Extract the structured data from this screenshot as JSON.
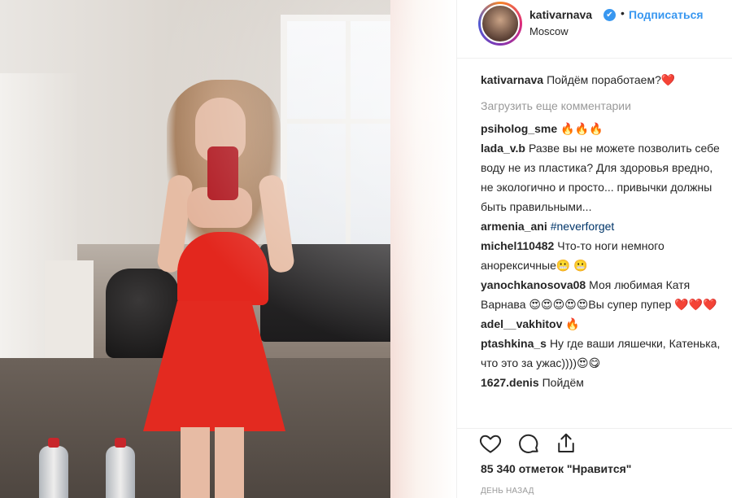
{
  "post": {
    "username": "kativarnava",
    "verified_mark": "✔",
    "dot": "•",
    "follow_label": "Подписаться",
    "location": "Moscow"
  },
  "caption": {
    "user": "kativarnava",
    "text": "Пойдём поработаем?",
    "emoji": "❤️"
  },
  "load_more_label": "Загрузить еще комментарии",
  "comments": [
    {
      "user": "psiholog_sme",
      "text": "",
      "emoji": "🔥🔥🔥"
    },
    {
      "user": "lada_v.b",
      "text": "Разве вы не можете позволить себе воду не из пластика? Для здоровья вредно, не экологично и просто... привычки должны быть правильными...",
      "emoji": ""
    },
    {
      "user": "armenia_ani",
      "text": "#neverforget",
      "emoji": ""
    },
    {
      "user": "michel110482",
      "text": "Что-то ноги немного анорексичные",
      "emoji": "😬 😬"
    },
    {
      "user": "yanochkanosova08",
      "text": "Моя любимая Катя Варнава",
      "emoji": "😍😍😍😍😍",
      "text2": "Вы супер пупер",
      "emoji2": "❤️❤️❤️"
    },
    {
      "user": "adel__vakhitov",
      "text": "",
      "emoji": "🔥"
    },
    {
      "user": "ptashkina_s",
      "text": "Ну где ваши ляшечки, Катенька, что это за ужас))))",
      "emoji": "😍😋"
    },
    {
      "user": "1627.denis",
      "text": "Пойдём",
      "emoji": ""
    }
  ],
  "likes_label": "85 340 отметок \"Нравится\"",
  "date_label": "ДЕНЬ НАЗАД",
  "icons": {
    "like": "heart-icon",
    "comment": "comment-icon",
    "share": "share-icon"
  },
  "colors": {
    "link_blue": "#3897f0",
    "hashtag": "#003569",
    "muted": "#999999"
  }
}
